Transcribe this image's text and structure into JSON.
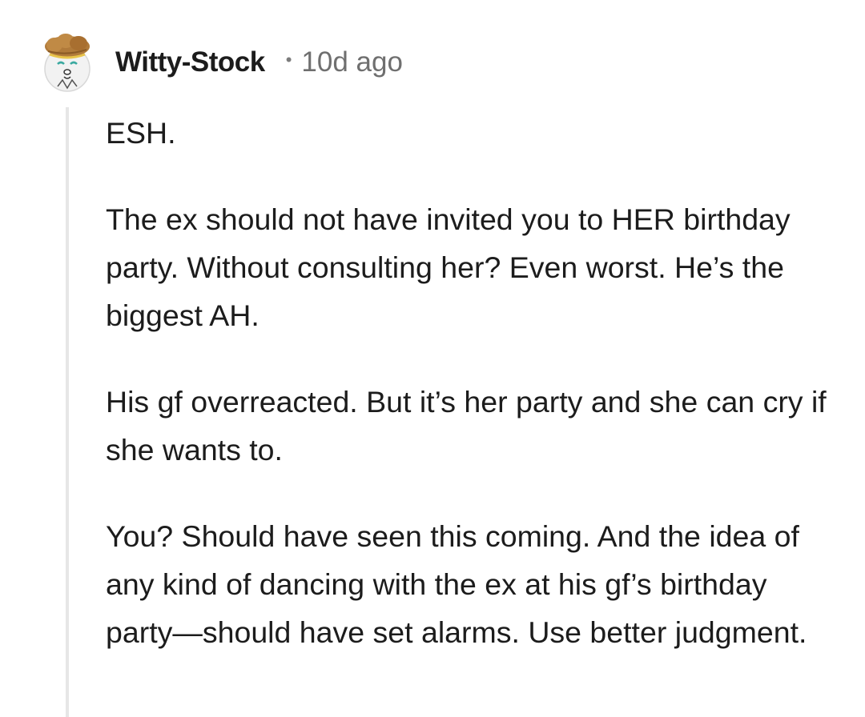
{
  "comment": {
    "author": "Witty-Stock",
    "separator": "•",
    "age": "10d ago",
    "avatar_icon": "reddit-snoo-avatar-icon",
    "paragraphs": [
      "ESH.",
      "The ex should not have invited you to HER birthday party. Without consulting her? Even worst. He’s the biggest AH.",
      "His gf overreacted. But it’s her party and she can cry if she wants to.",
      "You? Should have seen this coming. And the idea of any kind of dancing with the ex at his gf’s birthday party—should have set alarms. Use better judgment."
    ]
  },
  "colors": {
    "text": "#1c1c1c",
    "meta": "#6f6f6f",
    "thread_line": "#e6e6e6",
    "hair": "#b07a3a"
  }
}
